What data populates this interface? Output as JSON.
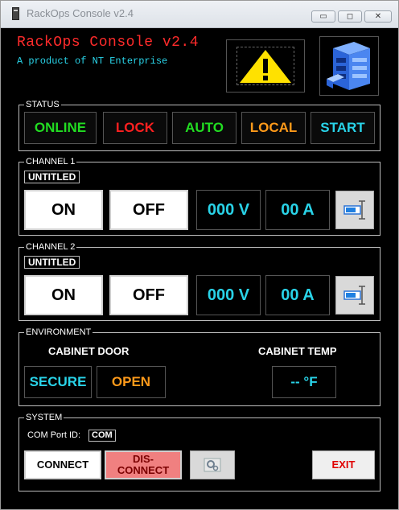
{
  "window": {
    "title": "RackOps Console v2.4",
    "min_glyph": "▭",
    "max_glyph": "◻",
    "close_glyph": "✕"
  },
  "header": {
    "title": "RackOps Console v2.4",
    "subtitle": "A product of NT Enterprise"
  },
  "status": {
    "label": "STATUS",
    "buttons": [
      {
        "label": "ONLINE",
        "color": "#22dd22"
      },
      {
        "label": "LOCK",
        "color": "#ff2020"
      },
      {
        "label": "AUTO",
        "color": "#22dd22"
      },
      {
        "label": "LOCAL",
        "color": "#ff9a1a"
      },
      {
        "label": "START",
        "color": "#29d3e8"
      }
    ]
  },
  "channels": [
    {
      "label": "CHANNEL 1",
      "name": "UNTITLED",
      "on_label": "ON",
      "off_label": "OFF",
      "voltage": "000 V",
      "current": "00 A"
    },
    {
      "label": "CHANNEL 2",
      "name": "UNTITLED",
      "on_label": "ON",
      "off_label": "OFF",
      "voltage": "000 V",
      "current": "00 A"
    }
  ],
  "environment": {
    "label": "ENVIRONMENT",
    "door_heading": "CABINET DOOR",
    "temp_heading": "CABINET TEMP",
    "secure_label": "SECURE",
    "open_label": "OPEN",
    "temp_value": "-- °F",
    "colors": {
      "secure": "#29d3e8",
      "open": "#ff9a1a"
    }
  },
  "system": {
    "label": "SYSTEM",
    "com_port_label": "COM Port ID:",
    "com_port_value": "COM",
    "connect_label": "CONNECT",
    "disconnect_label_1": "DIS-",
    "disconnect_label_2": "CONNECT",
    "exit_label": "EXIT"
  },
  "icons": [
    "warning-icon",
    "server-rack-icon",
    "slider-icon",
    "settings-icon",
    "app-icon"
  ]
}
